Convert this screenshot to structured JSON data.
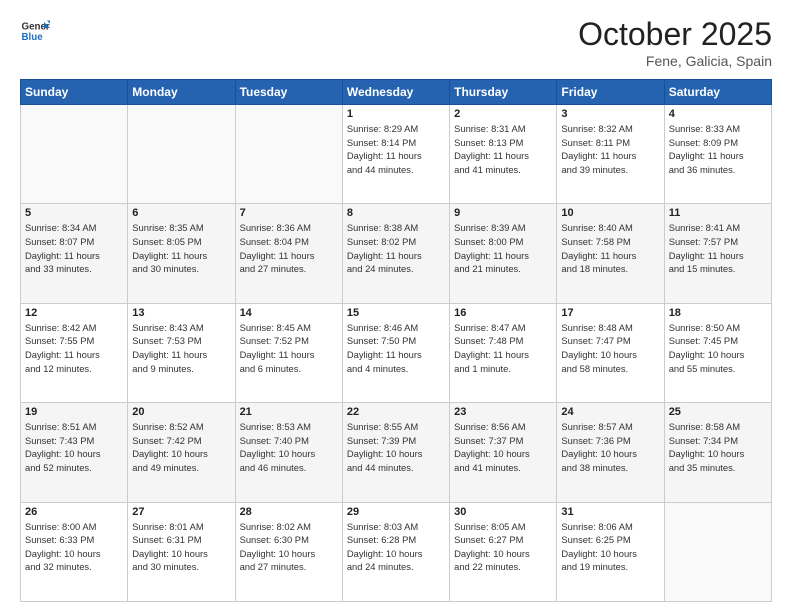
{
  "header": {
    "title": "October 2025",
    "location": "Fene, Galicia, Spain"
  },
  "logo": {
    "line1": "General",
    "line2": "Blue"
  },
  "days_of_week": [
    "Sunday",
    "Monday",
    "Tuesday",
    "Wednesday",
    "Thursday",
    "Friday",
    "Saturday"
  ],
  "weeks": [
    [
      {
        "day": "",
        "info": ""
      },
      {
        "day": "",
        "info": ""
      },
      {
        "day": "",
        "info": ""
      },
      {
        "day": "1",
        "info": "Sunrise: 8:29 AM\nSunset: 8:14 PM\nDaylight: 11 hours\nand 44 minutes."
      },
      {
        "day": "2",
        "info": "Sunrise: 8:31 AM\nSunset: 8:13 PM\nDaylight: 11 hours\nand 41 minutes."
      },
      {
        "day": "3",
        "info": "Sunrise: 8:32 AM\nSunset: 8:11 PM\nDaylight: 11 hours\nand 39 minutes."
      },
      {
        "day": "4",
        "info": "Sunrise: 8:33 AM\nSunset: 8:09 PM\nDaylight: 11 hours\nand 36 minutes."
      }
    ],
    [
      {
        "day": "5",
        "info": "Sunrise: 8:34 AM\nSunset: 8:07 PM\nDaylight: 11 hours\nand 33 minutes."
      },
      {
        "day": "6",
        "info": "Sunrise: 8:35 AM\nSunset: 8:05 PM\nDaylight: 11 hours\nand 30 minutes."
      },
      {
        "day": "7",
        "info": "Sunrise: 8:36 AM\nSunset: 8:04 PM\nDaylight: 11 hours\nand 27 minutes."
      },
      {
        "day": "8",
        "info": "Sunrise: 8:38 AM\nSunset: 8:02 PM\nDaylight: 11 hours\nand 24 minutes."
      },
      {
        "day": "9",
        "info": "Sunrise: 8:39 AM\nSunset: 8:00 PM\nDaylight: 11 hours\nand 21 minutes."
      },
      {
        "day": "10",
        "info": "Sunrise: 8:40 AM\nSunset: 7:58 PM\nDaylight: 11 hours\nand 18 minutes."
      },
      {
        "day": "11",
        "info": "Sunrise: 8:41 AM\nSunset: 7:57 PM\nDaylight: 11 hours\nand 15 minutes."
      }
    ],
    [
      {
        "day": "12",
        "info": "Sunrise: 8:42 AM\nSunset: 7:55 PM\nDaylight: 11 hours\nand 12 minutes."
      },
      {
        "day": "13",
        "info": "Sunrise: 8:43 AM\nSunset: 7:53 PM\nDaylight: 11 hours\nand 9 minutes."
      },
      {
        "day": "14",
        "info": "Sunrise: 8:45 AM\nSunset: 7:52 PM\nDaylight: 11 hours\nand 6 minutes."
      },
      {
        "day": "15",
        "info": "Sunrise: 8:46 AM\nSunset: 7:50 PM\nDaylight: 11 hours\nand 4 minutes."
      },
      {
        "day": "16",
        "info": "Sunrise: 8:47 AM\nSunset: 7:48 PM\nDaylight: 11 hours\nand 1 minute."
      },
      {
        "day": "17",
        "info": "Sunrise: 8:48 AM\nSunset: 7:47 PM\nDaylight: 10 hours\nand 58 minutes."
      },
      {
        "day": "18",
        "info": "Sunrise: 8:50 AM\nSunset: 7:45 PM\nDaylight: 10 hours\nand 55 minutes."
      }
    ],
    [
      {
        "day": "19",
        "info": "Sunrise: 8:51 AM\nSunset: 7:43 PM\nDaylight: 10 hours\nand 52 minutes."
      },
      {
        "day": "20",
        "info": "Sunrise: 8:52 AM\nSunset: 7:42 PM\nDaylight: 10 hours\nand 49 minutes."
      },
      {
        "day": "21",
        "info": "Sunrise: 8:53 AM\nSunset: 7:40 PM\nDaylight: 10 hours\nand 46 minutes."
      },
      {
        "day": "22",
        "info": "Sunrise: 8:55 AM\nSunset: 7:39 PM\nDaylight: 10 hours\nand 44 minutes."
      },
      {
        "day": "23",
        "info": "Sunrise: 8:56 AM\nSunset: 7:37 PM\nDaylight: 10 hours\nand 41 minutes."
      },
      {
        "day": "24",
        "info": "Sunrise: 8:57 AM\nSunset: 7:36 PM\nDaylight: 10 hours\nand 38 minutes."
      },
      {
        "day": "25",
        "info": "Sunrise: 8:58 AM\nSunset: 7:34 PM\nDaylight: 10 hours\nand 35 minutes."
      }
    ],
    [
      {
        "day": "26",
        "info": "Sunrise: 8:00 AM\nSunset: 6:33 PM\nDaylight: 10 hours\nand 32 minutes."
      },
      {
        "day": "27",
        "info": "Sunrise: 8:01 AM\nSunset: 6:31 PM\nDaylight: 10 hours\nand 30 minutes."
      },
      {
        "day": "28",
        "info": "Sunrise: 8:02 AM\nSunset: 6:30 PM\nDaylight: 10 hours\nand 27 minutes."
      },
      {
        "day": "29",
        "info": "Sunrise: 8:03 AM\nSunset: 6:28 PM\nDaylight: 10 hours\nand 24 minutes."
      },
      {
        "day": "30",
        "info": "Sunrise: 8:05 AM\nSunset: 6:27 PM\nDaylight: 10 hours\nand 22 minutes."
      },
      {
        "day": "31",
        "info": "Sunrise: 8:06 AM\nSunset: 6:25 PM\nDaylight: 10 hours\nand 19 minutes."
      },
      {
        "day": "",
        "info": ""
      }
    ]
  ]
}
